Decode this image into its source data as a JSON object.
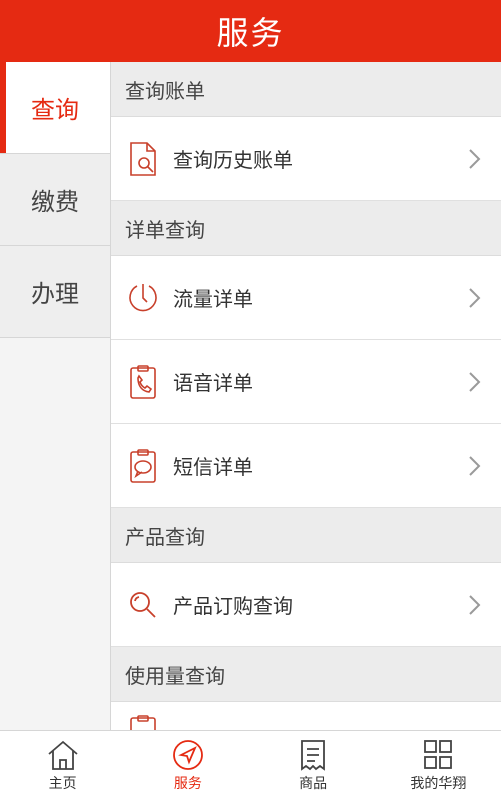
{
  "header": {
    "title": "服务"
  },
  "sidebar": {
    "items": [
      {
        "label": "查询",
        "active": true
      },
      {
        "label": "缴费",
        "active": false
      },
      {
        "label": "办理",
        "active": false
      }
    ]
  },
  "sections": [
    {
      "title": "查询账单",
      "rows": [
        {
          "label": "查询历史账单",
          "icon": "bill-search-icon"
        }
      ]
    },
    {
      "title": "详单查询",
      "rows": [
        {
          "label": "流量详单",
          "icon": "data-gauge-icon"
        },
        {
          "label": "语音详单",
          "icon": "phone-clipboard-icon"
        },
        {
          "label": "短信详单",
          "icon": "sms-clipboard-icon"
        }
      ]
    },
    {
      "title": "产品查询",
      "rows": [
        {
          "label": "产品订购查询",
          "icon": "search-icon"
        }
      ]
    },
    {
      "title": "使用量查询",
      "rows": []
    }
  ],
  "tabbar": {
    "items": [
      {
        "label": "主页",
        "icon": "home-icon",
        "active": false
      },
      {
        "label": "服务",
        "icon": "navigation-icon",
        "active": true
      },
      {
        "label": "商品",
        "icon": "receipt-icon",
        "active": false
      },
      {
        "label": "我的华翔",
        "icon": "grid-icon",
        "active": false
      }
    ]
  },
  "colors": {
    "accent": "#e52a12",
    "icon_stroke": "#c8402b"
  }
}
